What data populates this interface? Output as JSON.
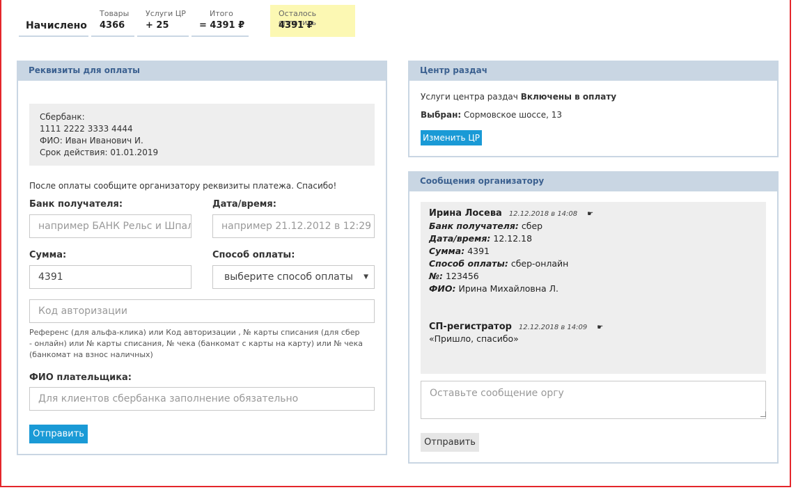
{
  "summary": {
    "title": "Начислено",
    "goods_caption": "Товары",
    "goods_value": "4366",
    "services_caption": "Услуги ЦР",
    "services_value": "+ 25",
    "total_caption": "Итого",
    "total_value": "= 4391 ₽",
    "remain_caption": "Осталось оплатить",
    "remain_value": "4391 ₽"
  },
  "payment": {
    "header": "Реквизиты для оплаты",
    "details": [
      "Сбербанк:",
      "1111 2222 3333 4444",
      "ФИО: Иван Иванович И.",
      "Срок действия: 01.01.2019"
    ],
    "notice": "После оплаты сообщите организатору реквизиты платежа. Спасибо!",
    "bank_label": "Банк получателя:",
    "bank_placeholder": "например БАНК Рельс и Шпалы",
    "datetime_label": "Дата/время:",
    "datetime_placeholder": "например 21.12.2012 в 12:29",
    "sum_label": "Сумма:",
    "sum_value": "4391",
    "method_label": "Способ оплаты:",
    "method_value": "выберите способ оплаты",
    "auth_placeholder": "Код авторизации",
    "hint": "Референс (для альфа-клика) или Код авторизации , № карты списания (для сбер - онлайн) или № карты списания, № чека (банкомат с карты на карту) или № чека (банкомат на взнос наличных)",
    "payer_label": "ФИО плательщика:",
    "payer_placeholder": "Для клиентов сбербанка заполнение обязательно",
    "submit": "Отправить"
  },
  "center": {
    "header": "Центр раздач",
    "services_text": "Услуги центра раздач",
    "services_status": "Включены в оплату",
    "selected_label": "Выбран:",
    "selected_value": "Сормовское шоссе, 13",
    "change_button": "Изменить ЦР"
  },
  "messages": {
    "header": "Сообщения организатору",
    "msg1": {
      "author": "Ирина Лосева",
      "time": "12.12.2018 в 14:08",
      "bank_label": "Банк получателя:",
      "bank_value": "сбер",
      "date_label": "Дата/время:",
      "date_value": "12.12.18",
      "sum_label": "Сумма:",
      "sum_value": "4391",
      "method_label": "Способ оплаты:",
      "method_value": "сбер-онлайн",
      "num_label": "№:",
      "num_value": "123456",
      "fio_label": "ФИО:",
      "fio_value": "Ирина Михайловна Л."
    },
    "msg2": {
      "author": "СП-регистратор",
      "time": "12.12.2018 в 14:09",
      "text": "«Пришло, спасибо»"
    },
    "input_placeholder": "Оставьте сообщение оргу",
    "submit": "Отправить"
  },
  "colors": {
    "accent": "#1a9ad6",
    "panel_header": "#c9d6e3",
    "header_text": "#3c6190",
    "remain_bg": "#fcf8b3",
    "frame": "#e4262b"
  }
}
